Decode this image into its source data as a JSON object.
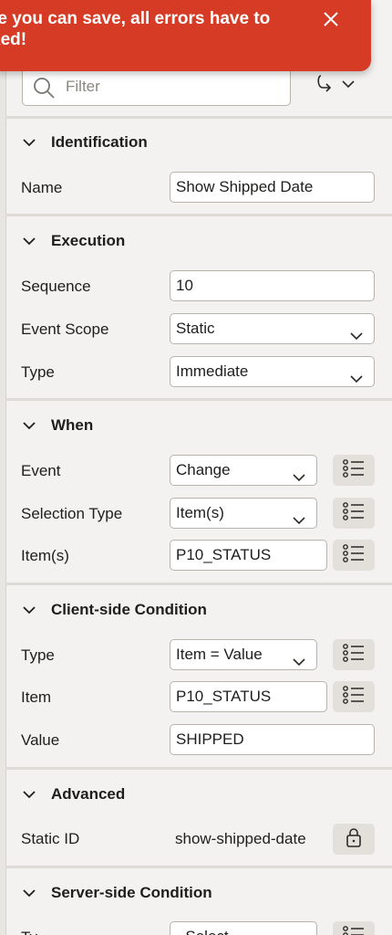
{
  "toast": {
    "message": "re you can save, all errors have to\nked!",
    "close_icon": "close-icon"
  },
  "filter": {
    "placeholder": "Filter"
  },
  "sections": {
    "identification": {
      "title": "Identification",
      "name_label": "Name",
      "name_value": "Show Shipped Date"
    },
    "execution": {
      "title": "Execution",
      "sequence_label": "Sequence",
      "sequence_value": "10",
      "event_scope_label": "Event Scope",
      "event_scope_value": "Static",
      "type_label": "Type",
      "type_value": "Immediate"
    },
    "when": {
      "title": "When",
      "event_label": "Event",
      "event_value": "Change",
      "selection_type_label": "Selection Type",
      "selection_type_value": "Item(s)",
      "items_label": "Item(s)",
      "items_value": "P10_STATUS"
    },
    "client_condition": {
      "title": "Client-side Condition",
      "type_label": "Type",
      "type_value": "Item = Value",
      "item_label": "Item",
      "item_value": "P10_STATUS",
      "value_label": "Value",
      "value_value": "SHIPPED"
    },
    "advanced": {
      "title": "Advanced",
      "static_id_label": "Static ID",
      "static_id_value": "show-shipped-date"
    },
    "server_condition": {
      "title": "Server-side Condition",
      "type_label": "Ty",
      "type_value": "- Select -"
    }
  },
  "colors": {
    "toast_bg": "#d63b25",
    "panel_bg": "#f3f2f0",
    "button_bg": "#e3e0dc"
  }
}
